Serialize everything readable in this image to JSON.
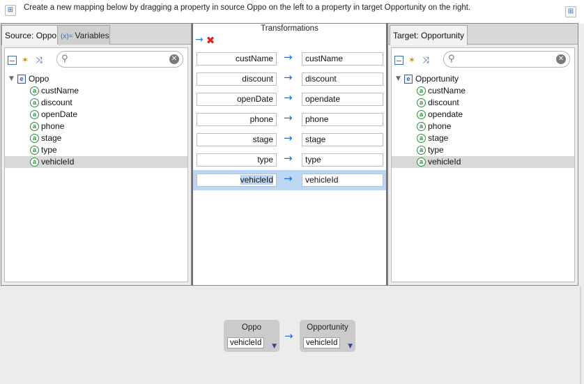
{
  "instruction": "Create a new mapping below by dragging a property in source Oppo on the left to a property in target Opportunity on the right.",
  "source_panel": {
    "tabs": [
      "Source: Oppo",
      "Variables"
    ],
    "variables_icon": "(x)=",
    "root": "Oppo",
    "items": [
      "custName",
      "discount",
      "openDate",
      "phone",
      "stage",
      "type",
      "vehicleId"
    ],
    "selected_item": "vehicleId"
  },
  "transformations": {
    "title": "Transformations",
    "mappings": [
      {
        "source": "custName",
        "target": "custName"
      },
      {
        "source": "discount",
        "target": "discount"
      },
      {
        "source": "openDate",
        "target": "opendate"
      },
      {
        "source": "phone",
        "target": "phone"
      },
      {
        "source": "stage",
        "target": "stage"
      },
      {
        "source": "type",
        "target": "type"
      },
      {
        "source": "vehicleId",
        "target": "vehicleId"
      }
    ],
    "selected_index": 6
  },
  "target_panel": {
    "tabs": [
      "Target: Opportunity"
    ],
    "root": "Opportunity",
    "items": [
      "custName",
      "discount",
      "opendate",
      "phone",
      "stage",
      "type",
      "vehicleId"
    ],
    "selected_item": "vehicleId"
  },
  "detail": {
    "source_title": "Oppo",
    "source_value": "vehicleId",
    "target_title": "Opportunity",
    "target_value": "vehicleId"
  },
  "icons": {
    "element": "e",
    "attribute": "a",
    "arrow": "→",
    "tree_icon": "⊟",
    "search": "🔍",
    "clear": "✖"
  },
  "colors": {
    "selection": "#bcd6f3",
    "arrow": "#1a6fd8",
    "attribute": "#2e8b3a",
    "delete": "#dd2222"
  }
}
